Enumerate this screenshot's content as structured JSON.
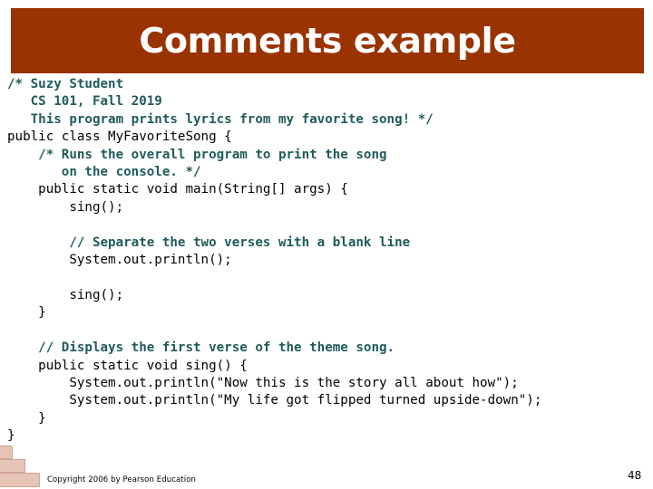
{
  "slide": {
    "title": "Comments example",
    "banner_color": "#993300",
    "background_color": "#ffffff",
    "page_number": "48",
    "copyright": "Copyright 2006 by Pearson Education"
  },
  "code": {
    "comment_color": "#1f5b5b",
    "code_color": "#000000",
    "lines": [
      {
        "kind": "comment",
        "text": "/* Suzy Student"
      },
      {
        "kind": "comment",
        "text": "   CS 101, Fall 2019"
      },
      {
        "kind": "comment",
        "text": "   This program prints lyrics from my favorite song! */"
      },
      {
        "kind": "code",
        "text": "public class MyFavoriteSong {"
      },
      {
        "kind": "comment",
        "text": "    /* Runs the overall program to print the song"
      },
      {
        "kind": "comment",
        "text": "       on the console. */"
      },
      {
        "kind": "code",
        "text": "    public static void main(String[] args) {"
      },
      {
        "kind": "code",
        "text": "        sing();"
      },
      {
        "kind": "blank",
        "text": " "
      },
      {
        "kind": "comment",
        "text": "        // Separate the two verses with a blank line"
      },
      {
        "kind": "code",
        "text": "        System.out.println();"
      },
      {
        "kind": "blank",
        "text": " "
      },
      {
        "kind": "code",
        "text": "        sing();"
      },
      {
        "kind": "code",
        "text": "    }"
      },
      {
        "kind": "blank",
        "text": " "
      },
      {
        "kind": "comment",
        "text": "    // Displays the first verse of the theme song."
      },
      {
        "kind": "code",
        "text": "    public static void sing() {"
      },
      {
        "kind": "code",
        "text": "        System.out.println(\"Now this is the story all about how\");"
      },
      {
        "kind": "code",
        "text": "        System.out.println(\"My life got flipped turned upside-down\");"
      },
      {
        "kind": "code",
        "text": "    }"
      },
      {
        "kind": "code",
        "text": "}"
      }
    ]
  },
  "decoration": {
    "brick_stair_label": "brick-stair-graphic",
    "brick_fill": "#e6c4b6",
    "brick_stroke": "#cfa495"
  }
}
